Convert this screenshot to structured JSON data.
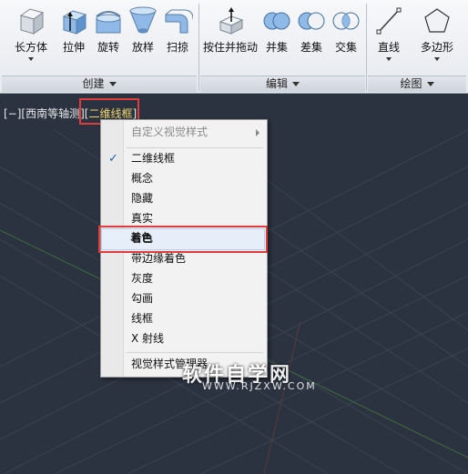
{
  "ribbon": {
    "tools": [
      {
        "label": "长方体",
        "icon": "box-icon",
        "dropdown": true
      },
      {
        "label": "拉伸",
        "icon": "extrude-icon"
      },
      {
        "label": "旋转",
        "icon": "revolve-icon"
      },
      {
        "label": "放样",
        "icon": "loft-icon"
      },
      {
        "label": "扫掠",
        "icon": "sweep-icon"
      },
      {
        "label": "按住并拖动",
        "icon": "presspull-icon"
      },
      {
        "label": "并集",
        "icon": "union-icon"
      },
      {
        "label": "差集",
        "icon": "subtract-icon"
      },
      {
        "label": "交集",
        "icon": "intersect-icon"
      },
      {
        "label": "直线",
        "icon": "line-icon",
        "dropdown": true
      },
      {
        "label": "多边形",
        "icon": "polygon-icon",
        "dropdown": true
      }
    ],
    "panels": [
      {
        "label": "创建"
      },
      {
        "label": "编辑"
      },
      {
        "label": "绘图"
      }
    ]
  },
  "viewport": {
    "label_prefix": "[−][西南等轴测][",
    "visual_style": "二维线框",
    "label_suffix": "]"
  },
  "menu": {
    "header": "自定义视觉样式",
    "items": [
      {
        "label": "二维线框",
        "checked": true
      },
      {
        "label": "概念"
      },
      {
        "label": "隐藏"
      },
      {
        "label": "真实"
      },
      {
        "label": "着色",
        "highlighted": true
      },
      {
        "label": "带边缘着色"
      },
      {
        "label": "灰度"
      },
      {
        "label": "勾画"
      },
      {
        "label": "线框"
      },
      {
        "label": "X 射线"
      }
    ],
    "footer": "视觉样式管理器..."
  },
  "watermark": {
    "title": "软件自学网",
    "url": "WWW.RJZXW.COM"
  },
  "colors": {
    "highlight": "#e23b3b",
    "viewport_bg": "#2b3340",
    "visual_style_text": "#f2d66a",
    "check": "#1f5fb8"
  }
}
